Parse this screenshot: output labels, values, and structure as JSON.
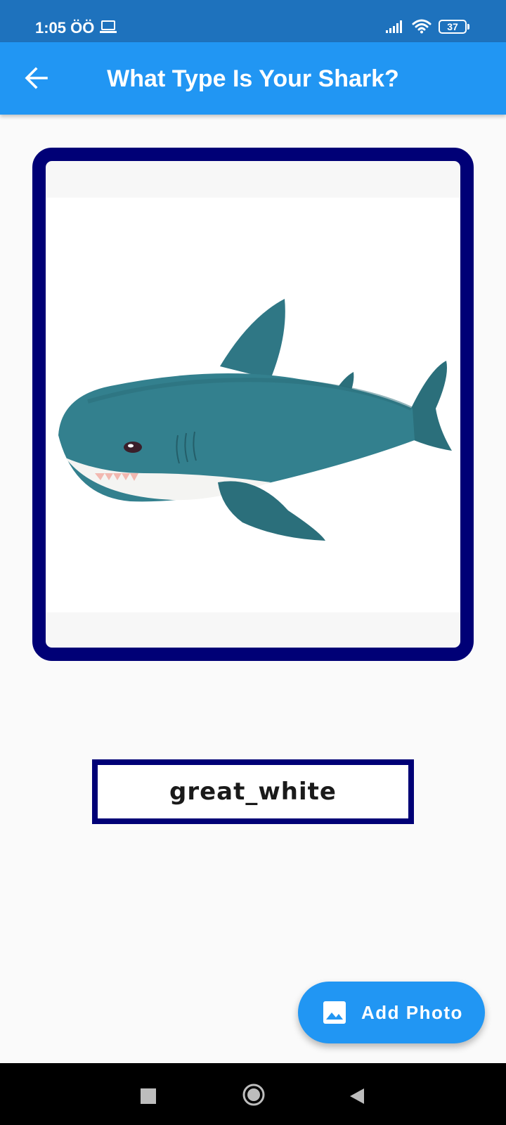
{
  "status_bar": {
    "time": "1:05 ÖÖ",
    "battery_level": "37",
    "icons": [
      "laptop-icon",
      "signal-icon",
      "wifi-icon",
      "battery-icon"
    ]
  },
  "app_bar": {
    "title": "What Type Is Your Shark?",
    "back_icon": "arrow-left-icon",
    "background": "#2196f3"
  },
  "image": {
    "subject": "teal plush shark toy",
    "frame_color": "#000076"
  },
  "prediction": {
    "label": "great_white",
    "border_color": "#000076"
  },
  "fab": {
    "label": "Add Photo",
    "icon": "image-icon",
    "background": "#2196f3"
  },
  "nav_bar": {
    "icons": [
      "recents-icon",
      "home-icon",
      "back-triangle-icon"
    ]
  },
  "colors": {
    "status_bar": "#1e72bd",
    "accent": "#2196f3",
    "frame": "#000076",
    "page_background": "#fafafa"
  }
}
